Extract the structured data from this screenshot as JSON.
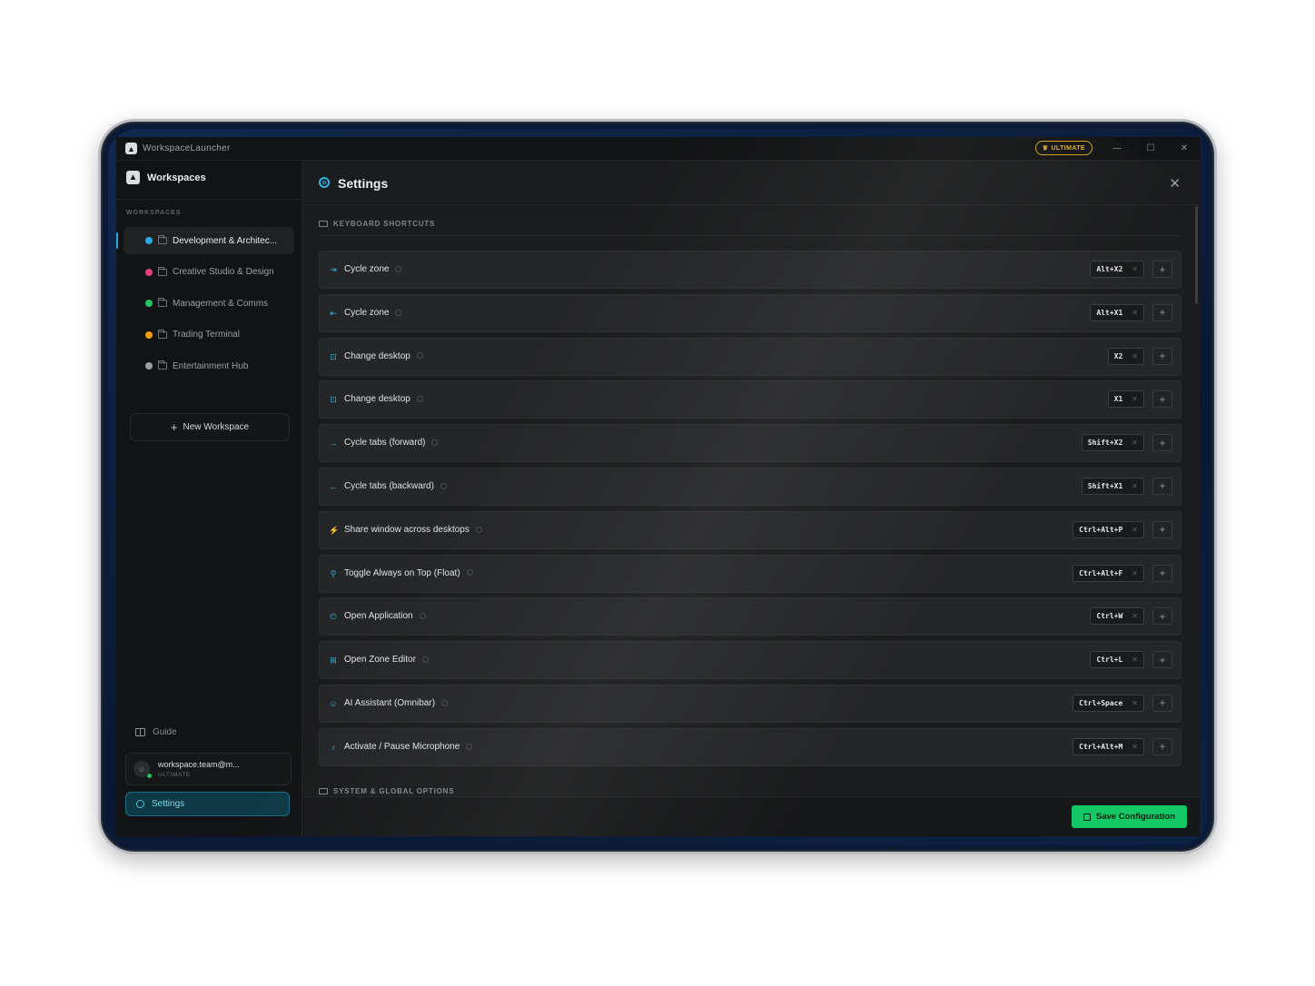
{
  "window": {
    "title": "WorkspaceLauncher",
    "badge": "ULTIMATE",
    "controls": {
      "minimize": "—",
      "maximize": "☐",
      "close": "✕"
    }
  },
  "sidebar": {
    "brand": "Workspaces",
    "section_label": "WORKSPACES",
    "items": [
      {
        "label": "Development & Architec...",
        "color": "#2aa8e6",
        "active": true
      },
      {
        "label": "Creative Studio & Design",
        "color": "#e23d7d",
        "active": false
      },
      {
        "label": "Management & Comms",
        "color": "#22c55e",
        "active": false
      },
      {
        "label": "Trading Terminal",
        "color": "#f59e0b",
        "active": false
      },
      {
        "label": "Entertainment Hub",
        "color": "#9aa0a6",
        "active": false
      }
    ],
    "new_workspace": "New Workspace",
    "guide": "Guide",
    "user": {
      "name": "workspace.team@m...",
      "plan": "ULTIMATE"
    },
    "settings": "Settings"
  },
  "main": {
    "title": "Settings",
    "close": "✕",
    "section_shortcuts": "KEYBOARD SHORTCUTS",
    "section_system": "SYSTEM & GLOBAL OPTIONS",
    "shortcuts": [
      {
        "icon": "⇥",
        "label": "Cycle zone",
        "key": "Alt+X2"
      },
      {
        "icon": "⇤",
        "label": "Cycle zone",
        "key": "Alt+X1"
      },
      {
        "icon": "⊡",
        "label": "Change desktop",
        "key": "X2"
      },
      {
        "icon": "⊡",
        "label": "Change desktop",
        "key": "X1"
      },
      {
        "icon": "→",
        "label": "Cycle tabs (forward)",
        "key": "Shift+X2"
      },
      {
        "icon": "←",
        "label": "Cycle tabs (backward)",
        "key": "Shift+X1"
      },
      {
        "icon": "⚡",
        "label": "Share window across desktops",
        "key": "Ctrl+Alt+P"
      },
      {
        "icon": "⚲",
        "label": "Toggle Always on Top (Float)",
        "key": "Ctrl+Alt+F"
      },
      {
        "icon": "⏻",
        "label": "Open Application",
        "key": "Ctrl+W"
      },
      {
        "icon": "⊞",
        "label": "Open Zone Editor",
        "key": "Ctrl+L"
      },
      {
        "icon": "☺",
        "label": "AI Assistant (Omnibar)",
        "key": "Ctrl+Space"
      },
      {
        "icon": "♪",
        "label": "Activate / Pause Microphone",
        "key": "Ctrl+Alt+M"
      }
    ],
    "remove_glyph": "✕",
    "add_glyph": "+",
    "save": "Save Configuration"
  }
}
